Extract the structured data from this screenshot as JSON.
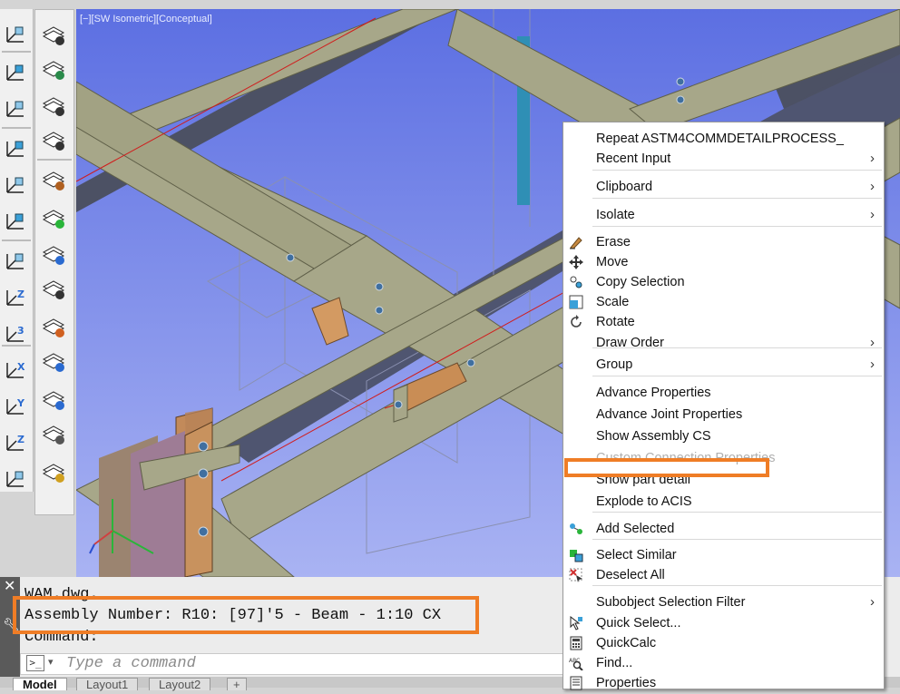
{
  "viewport": {
    "label": "[−][SW Isometric][Conceptual]"
  },
  "toolbar_left": {
    "icons": [
      "ucs-world-icon",
      "ucs-view-icon",
      "ucs-previous-icon",
      "ucs-face-icon",
      "ucs-object-icon",
      "ucs-view-plane-icon",
      "ucs-origin-icon",
      "ucs-z-axis-icon",
      "ucs-3point-icon",
      "ucs-x-rotate-icon",
      "ucs-y-rotate-icon",
      "ucs-z-rotate-icon",
      "ucs-manager-icon"
    ]
  },
  "toolbar_layers": {
    "icons": [
      "layer-properties-icon",
      "layer-states-icon",
      "layer-previous-icon",
      "layer-list-icon",
      "layer-match-icon",
      "layer-make-current-icon",
      "layer-isolate-icon",
      "layer-unisolate-icon",
      "layer-off-icon",
      "layer-freeze-icon",
      "layer-on-icon",
      "layer-lock-icon",
      "layer-unlock-icon"
    ]
  },
  "command": {
    "lines": [
      "WAM.dwg.",
      "Assembly Number: R10: [97]'5 - Beam - 1:10 CX",
      "Command:"
    ],
    "placeholder": "Type a command"
  },
  "tabs": [
    "Model",
    "Layout1",
    "Layout2",
    "+"
  ],
  "context_menu": {
    "items": [
      {
        "label": "Repeat ASTM4COMMDETAILPROCESS_",
        "arrow": false,
        "icon": null,
        "disabled": false
      },
      {
        "label": "Recent Input",
        "arrow": true,
        "icon": null,
        "disabled": false
      },
      {
        "label": "Clipboard",
        "arrow": true,
        "icon": null,
        "disabled": false
      },
      {
        "label": "Isolate",
        "arrow": true,
        "icon": null,
        "disabled": false
      },
      {
        "label": "Erase",
        "arrow": false,
        "icon": "erase-icon",
        "disabled": false
      },
      {
        "label": "Move",
        "arrow": false,
        "icon": "move-icon",
        "disabled": false
      },
      {
        "label": "Copy Selection",
        "arrow": false,
        "icon": "copy-icon",
        "disabled": false
      },
      {
        "label": "Scale",
        "arrow": false,
        "icon": "scale-icon",
        "disabled": false
      },
      {
        "label": "Rotate",
        "arrow": false,
        "icon": "rotate-icon",
        "disabled": false
      },
      {
        "label": "Draw Order",
        "arrow": true,
        "icon": null,
        "disabled": false
      },
      {
        "label": "Group",
        "arrow": true,
        "icon": null,
        "disabled": false
      },
      {
        "label": "Advance Properties",
        "arrow": false,
        "icon": null,
        "disabled": false
      },
      {
        "label": "Advance Joint Properties",
        "arrow": false,
        "icon": null,
        "disabled": false
      },
      {
        "label": "Show Assembly CS",
        "arrow": false,
        "icon": null,
        "disabled": false
      },
      {
        "label": "Custom Connection Properties",
        "arrow": false,
        "icon": null,
        "disabled": true
      },
      {
        "label": "Show part detail",
        "arrow": false,
        "icon": null,
        "disabled": false
      },
      {
        "label": "Explode to ACIS",
        "arrow": false,
        "icon": null,
        "disabled": false
      },
      {
        "label": "Add Selected",
        "arrow": false,
        "icon": "add-selected-icon",
        "disabled": false
      },
      {
        "label": "Select Similar",
        "arrow": false,
        "icon": "select-similar-icon",
        "disabled": false
      },
      {
        "label": "Deselect All",
        "arrow": false,
        "icon": "deselect-all-icon",
        "disabled": false
      },
      {
        "label": "Subobject Selection Filter",
        "arrow": true,
        "icon": null,
        "disabled": false
      },
      {
        "label": "Quick Select...",
        "arrow": false,
        "icon": "quick-select-icon",
        "disabled": false
      },
      {
        "label": "QuickCalc",
        "arrow": false,
        "icon": "quickcalc-icon",
        "disabled": false
      },
      {
        "label": "Find...",
        "arrow": false,
        "icon": "find-icon",
        "disabled": false
      },
      {
        "label": "Properties",
        "arrow": false,
        "icon": "properties-icon",
        "disabled": false
      }
    ]
  },
  "colors": {
    "highlight": "#ef7d26",
    "viewport_top": "#5a6ee0",
    "viewport_bottom": "#a8b2f2",
    "beam": "#a8a88a"
  }
}
